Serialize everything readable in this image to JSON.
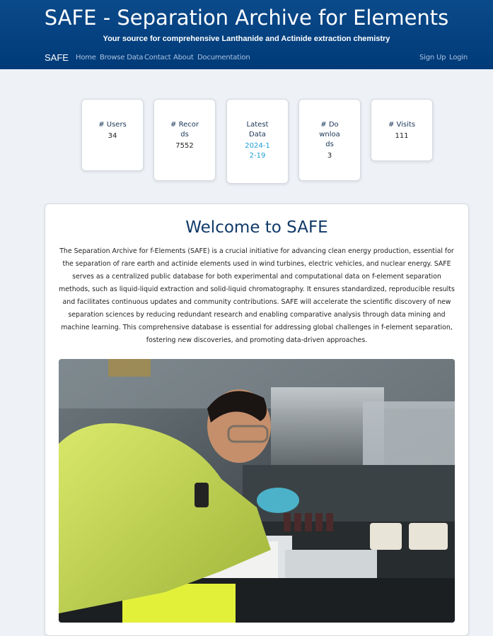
{
  "header": {
    "title": "SAFE - Separation Archive for Elements",
    "subtitle": "Your source for comprehensive Lanthanide and Actinide extraction chemistry"
  },
  "nav": {
    "brand": "SAFE",
    "links": [
      "Home",
      "Browse Data",
      "Contact",
      "About",
      "Documentation"
    ],
    "auth": [
      "Sign Up",
      "Login"
    ]
  },
  "stats": [
    {
      "label": "# Users",
      "value": "34"
    },
    {
      "label": "# Records",
      "value": "7552"
    },
    {
      "label": "Latest Data",
      "value": "2024-12-19"
    },
    {
      "label": "# Downloads",
      "value": "3"
    },
    {
      "label": "# Visits",
      "value": "111"
    }
  ],
  "main": {
    "heading": "Welcome to SAFE",
    "intro": "The Separation Archive for f-Elements (SAFE) is a crucial initiative for advancing clean energy production, essential for the separation of rare earth and actinide elements used in wind turbines, electric vehicles, and nuclear energy. SAFE serves as a centralized public database for both experimental and computational data on f-element separation methods, such as liquid-liquid extraction and solid-liquid chromatography. It ensures standardized, reproducible results and facilitates continuous updates and community contributions. SAFE will accelerate the scientific discovery of new separation sciences by reducing redundant research and enabling comparative analysis through data mining and machine learning. This comprehensive database is essential for addressing global challenges in f-element separation, fostering new discoveries, and promoting data-driven approaches."
  },
  "colors": {
    "header": "#003a78",
    "accent": "#1a9fd9",
    "heading": "#103a68"
  }
}
